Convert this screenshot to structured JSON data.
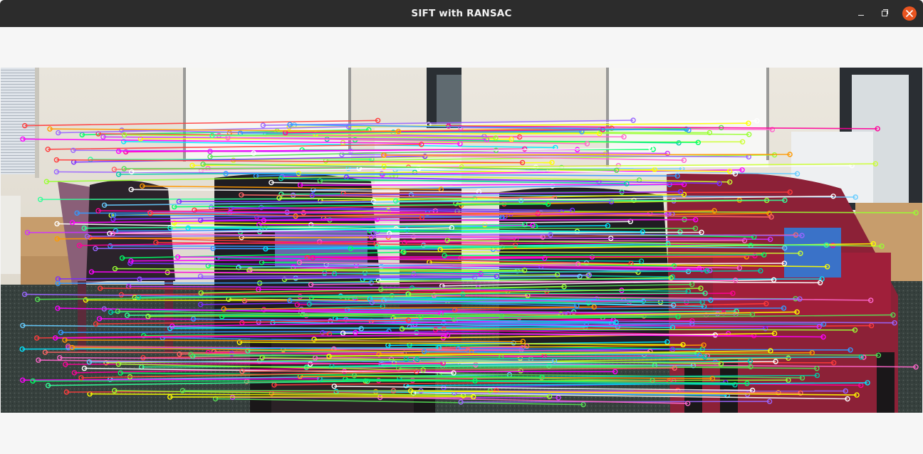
{
  "window": {
    "title": "SIFT with RANSAC",
    "controls": {
      "minimize_icon": "minimize-icon",
      "maximize_icon": "maximize-icon",
      "close_icon": "close-icon"
    },
    "accent_close": "#e95420",
    "titlebar_bg": "#2c2c2c"
  },
  "image": {
    "description_icon": "feature-match-visualization",
    "panels": [
      "left-image",
      "right-image"
    ]
  }
}
